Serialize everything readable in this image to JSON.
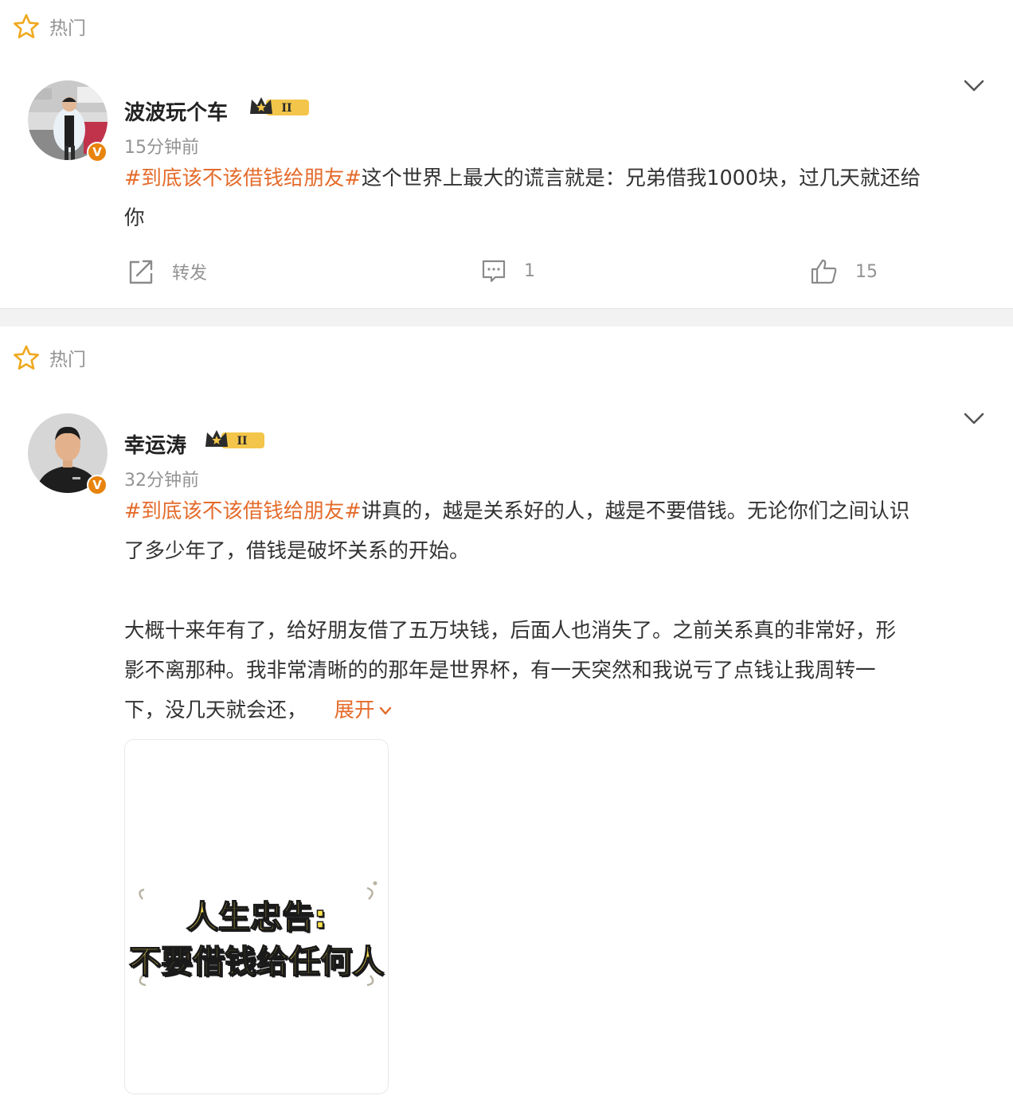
{
  "posts": [
    {
      "section_label": "热门",
      "author": "波波玩个车",
      "level_badge": "II",
      "time": "15分钟前",
      "topic": "#到底该不该借钱给朋友#",
      "text_lines": [
        "这个世界上最大的谎言就是：兄弟借我1000块，过几天就还给",
        "你"
      ],
      "actions": {
        "repost_label": "转发",
        "comments": "1",
        "likes": "15"
      }
    },
    {
      "section_label": "热门",
      "author": "幸运涛",
      "level_badge": "II",
      "time": "32分钟前",
      "topic": "#到底该不该借钱给朋友#",
      "para1_line1": "讲真的，越是关系好的人，越是不要借钱。无论你们之间认识",
      "para1_line2": "了多少年了，借钱是破坏关系的开始。",
      "para2_lines": [
        "大概十来年有了，给好朋友借了五万块钱，后面人也消失了。之前关系真的非常好，形",
        "影不离那种。我非常清晰的的那年是世界杯，有一天突然和我说亏了点钱让我周转一",
        "下，没几天就会还，"
      ],
      "expand_label": "展开",
      "image_text": {
        "line1": "人生忠告:",
        "line2": "不要借钱给任何人"
      }
    }
  ],
  "colors": {
    "topic": "#e46b2b",
    "badge": "#e8830c",
    "meta": "#939393"
  }
}
